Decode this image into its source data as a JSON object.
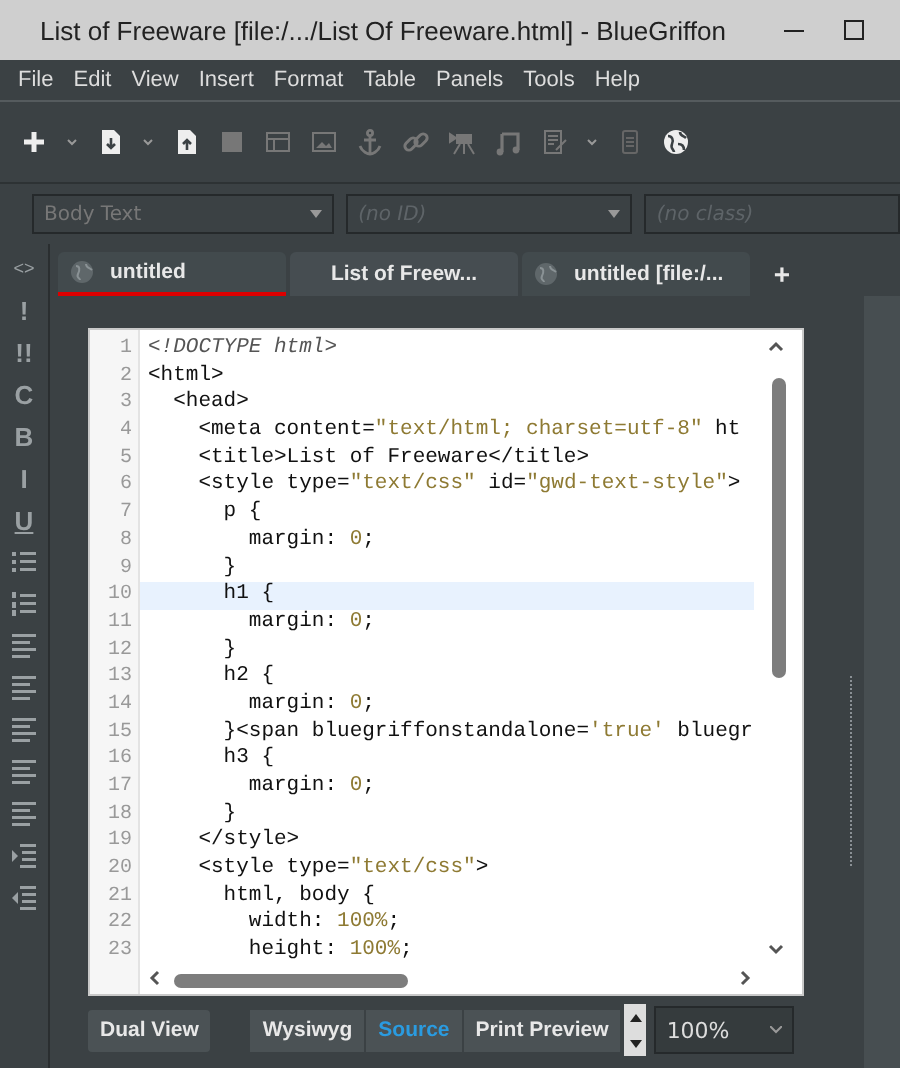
{
  "window": {
    "title": "List of Freeware [file:/.../List Of Freeware.html] - BlueGriffon"
  },
  "menu": [
    "File",
    "Edit",
    "View",
    "Insert",
    "Format",
    "Table",
    "Panels",
    "Tools",
    "Help"
  ],
  "format_bar": {
    "style": {
      "value": "Body Text"
    },
    "id": {
      "placeholder": "(no ID)"
    },
    "class": {
      "placeholder": "(no class)"
    }
  },
  "side_toolbar": [
    {
      "kind": "glyph",
      "text": "<>"
    },
    {
      "kind": "glyph",
      "text": "!"
    },
    {
      "kind": "glyph",
      "text": "!!"
    },
    {
      "kind": "glyph",
      "text": "C"
    },
    {
      "kind": "glyph",
      "text": "B"
    },
    {
      "kind": "glyph",
      "text": "I"
    },
    {
      "kind": "glyph",
      "text": "U"
    },
    {
      "kind": "icon"
    },
    {
      "kind": "icon"
    },
    {
      "kind": "icon"
    },
    {
      "kind": "icon"
    },
    {
      "kind": "icon"
    },
    {
      "kind": "icon"
    },
    {
      "kind": "icon"
    },
    {
      "kind": "icon"
    },
    {
      "kind": "icon"
    }
  ],
  "tabs": [
    {
      "label": "untitled",
      "selected": false,
      "flagged": true
    },
    {
      "label": "List of Freew...",
      "selected": true,
      "flagged": false
    },
    {
      "label": "untitled [file:/...",
      "selected": false,
      "flagged": false
    }
  ],
  "new_tab": "+",
  "source": {
    "lines": [
      {
        "number": "1",
        "current": false,
        "segments": [
          {
            "kind": "doctype",
            "text": "<!DOCTYPE html>"
          }
        ]
      },
      {
        "number": "2",
        "current": false,
        "segments": [
          {
            "kind": "tag",
            "text": "<html>"
          }
        ]
      },
      {
        "number": "3",
        "current": false,
        "segments": [
          {
            "kind": "tag",
            "text": "  <head>"
          }
        ]
      },
      {
        "number": "4",
        "current": false,
        "segments": [
          {
            "kind": "tag",
            "text": "    <meta content="
          },
          {
            "kind": "value",
            "text": "\"text/html; charset=utf-8\""
          },
          {
            "kind": "tag",
            "text": " ht"
          }
        ]
      },
      {
        "number": "5",
        "current": false,
        "segments": [
          {
            "kind": "tag",
            "text": "    <title>List of Freeware</title>"
          }
        ]
      },
      {
        "number": "6",
        "current": false,
        "segments": [
          {
            "kind": "tag",
            "text": "    <style type="
          },
          {
            "kind": "value",
            "text": "\"text/css\""
          },
          {
            "kind": "tag",
            "text": " id="
          },
          {
            "kind": "value",
            "text": "\"gwd-text-style\""
          },
          {
            "kind": "tag",
            "text": ">"
          }
        ]
      },
      {
        "number": "7",
        "current": false,
        "segments": [
          {
            "kind": "tag",
            "text": "      p {"
          }
        ]
      },
      {
        "number": "8",
        "current": false,
        "segments": [
          {
            "kind": "tag",
            "text": "        margin: "
          },
          {
            "kind": "value",
            "text": "0"
          },
          {
            "kind": "tag",
            "text": ";"
          }
        ]
      },
      {
        "number": "9",
        "current": false,
        "segments": [
          {
            "kind": "tag",
            "text": "      }"
          }
        ]
      },
      {
        "number": "10",
        "current": true,
        "segments": [
          {
            "kind": "tag",
            "text": "      h1 {"
          }
        ]
      },
      {
        "number": "11",
        "current": false,
        "segments": [
          {
            "kind": "tag",
            "text": "        margin: "
          },
          {
            "kind": "value",
            "text": "0"
          },
          {
            "kind": "tag",
            "text": ";"
          }
        ]
      },
      {
        "number": "12",
        "current": false,
        "segments": [
          {
            "kind": "tag",
            "text": "      }"
          }
        ]
      },
      {
        "number": "13",
        "current": false,
        "segments": [
          {
            "kind": "tag",
            "text": "      h2 {"
          }
        ]
      },
      {
        "number": "14",
        "current": false,
        "segments": [
          {
            "kind": "tag",
            "text": "        margin: "
          },
          {
            "kind": "value",
            "text": "0"
          },
          {
            "kind": "tag",
            "text": ";"
          }
        ]
      },
      {
        "number": "15",
        "current": false,
        "segments": [
          {
            "kind": "tag",
            "text": "      }<span bluegriffonstandalone="
          },
          {
            "kind": "value",
            "text": "'true'"
          },
          {
            "kind": "tag",
            "text": " bluegr"
          }
        ]
      },
      {
        "number": "16",
        "current": false,
        "segments": [
          {
            "kind": "tag",
            "text": "      h3 {"
          }
        ]
      },
      {
        "number": "17",
        "current": false,
        "segments": [
          {
            "kind": "tag",
            "text": "        margin: "
          },
          {
            "kind": "value",
            "text": "0"
          },
          {
            "kind": "tag",
            "text": ";"
          }
        ]
      },
      {
        "number": "18",
        "current": false,
        "segments": [
          {
            "kind": "tag",
            "text": "      }"
          }
        ]
      },
      {
        "number": "19",
        "current": false,
        "segments": [
          {
            "kind": "tag",
            "text": "    </style>"
          }
        ]
      },
      {
        "number": "20",
        "current": false,
        "segments": [
          {
            "kind": "tag",
            "text": "    <style type="
          },
          {
            "kind": "value",
            "text": "\"text/css\""
          },
          {
            "kind": "tag",
            "text": ">"
          }
        ]
      },
      {
        "number": "21",
        "current": false,
        "segments": [
          {
            "kind": "tag",
            "text": "      html, body {"
          }
        ]
      },
      {
        "number": "22",
        "current": false,
        "segments": [
          {
            "kind": "tag",
            "text": "        width: "
          },
          {
            "kind": "value",
            "text": "100%"
          },
          {
            "kind": "tag",
            "text": ";"
          }
        ]
      },
      {
        "number": "23",
        "current": false,
        "segments": [
          {
            "kind": "tag",
            "text": "        height: "
          },
          {
            "kind": "value",
            "text": "100%"
          },
          {
            "kind": "tag",
            "text": ";"
          }
        ]
      }
    ]
  },
  "bottom_bar": {
    "dual_view": "Dual View",
    "views": [
      {
        "label": "Wysiwyg",
        "selected": false
      },
      {
        "label": "Source",
        "selected": true
      },
      {
        "label": "Print Preview",
        "selected": false
      }
    ],
    "zoom": "100%"
  }
}
